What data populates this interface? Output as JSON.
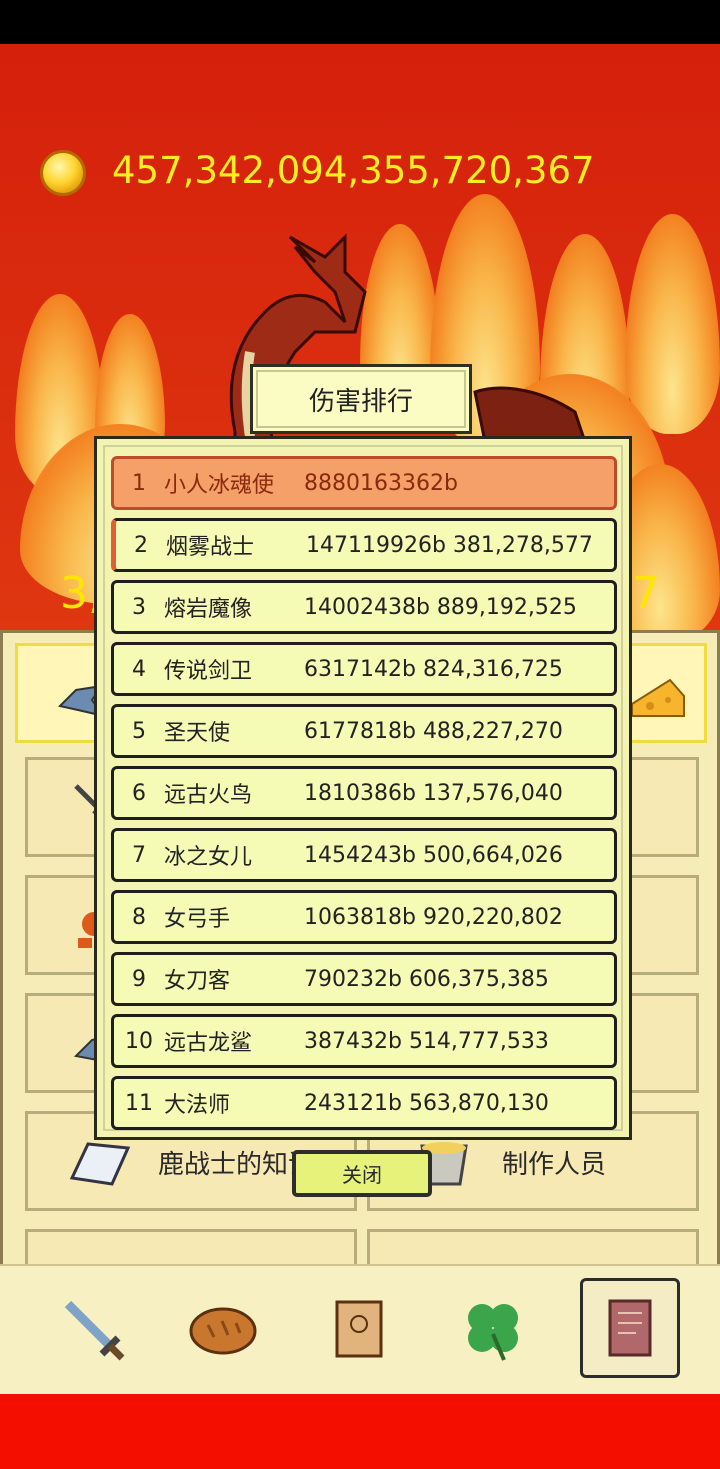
{
  "game": {
    "gold": "457,342,094,355,720,367",
    "partial_left": "3,",
    "partial_right": "7"
  },
  "tiles": {
    "knowledge_label": "鹿战士的知识",
    "credits_label": "制作人员"
  },
  "nav": {
    "icons": [
      "sword-icon",
      "bread-icon",
      "scroll-icon",
      "clover-icon",
      "book-icon"
    ]
  },
  "modal": {
    "title": "伤害排行",
    "close_label": "关闭",
    "rows": [
      {
        "rank": "1",
        "name": "小人冰魂使",
        "damage": "8880163362b"
      },
      {
        "rank": "2",
        "name": "烟雾战士",
        "damage": "147119926b 381,278,577"
      },
      {
        "rank": "3",
        "name": "熔岩魔像",
        "damage": "14002438b 889,192,525"
      },
      {
        "rank": "4",
        "name": "传说剑卫",
        "damage": "6317142b 824,316,725"
      },
      {
        "rank": "5",
        "name": "圣天使",
        "damage": "6177818b 488,227,270"
      },
      {
        "rank": "6",
        "name": "远古火鸟",
        "damage": "1810386b 137,576,040"
      },
      {
        "rank": "7",
        "name": "冰之女儿",
        "damage": "1454243b 500,664,026"
      },
      {
        "rank": "8",
        "name": "女弓手",
        "damage": "1063818b 920,220,802"
      },
      {
        "rank": "9",
        "name": "女刀客",
        "damage": "790232b 606,375,385"
      },
      {
        "rank": "10",
        "name": "远古龙鲨",
        "damage": "387432b 514,777,533"
      },
      {
        "rank": "11",
        "name": "大法师",
        "damage": "243121b 563,870,130"
      }
    ]
  },
  "colors": {
    "background": "#d42a0e",
    "gold_text": "#ffef22",
    "panel": "#f3f4b1",
    "first_row": "#f4a068"
  }
}
